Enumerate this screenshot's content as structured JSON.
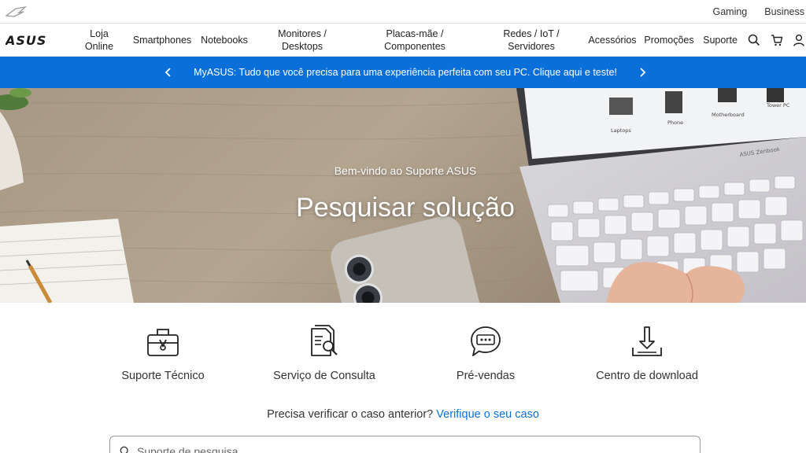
{
  "topbar": {
    "links": [
      "Gaming",
      "Business"
    ]
  },
  "nav": {
    "brand": "ASUS",
    "items": [
      {
        "line1": "Loja",
        "line2": "Online"
      },
      {
        "line1": "Smartphones",
        "line2": ""
      },
      {
        "line1": "Notebooks",
        "line2": ""
      },
      {
        "line1": "Monitores /",
        "line2": "Desktops"
      },
      {
        "line1": "Placas-mãe /",
        "line2": "Componentes"
      },
      {
        "line1": "Redes / IoT /",
        "line2": "Servidores"
      },
      {
        "line1": "Acessórios",
        "line2": ""
      },
      {
        "line1": "Promoções",
        "line2": ""
      },
      {
        "line1": "Suporte",
        "line2": ""
      }
    ],
    "icons": [
      "search-icon",
      "cart-icon",
      "user-icon"
    ]
  },
  "promo": {
    "text": "MyASUS: Tudo que você precisa para uma experiência perfeita com seu PC. Clique aqui e teste!"
  },
  "hero": {
    "subtitle": "Bem-vindo ao Suporte ASUS",
    "title": "Pesquisar solução",
    "laptop_brand": "ASUS Zenbook",
    "screen_labels": [
      "Laptops",
      "Phone",
      "Motherboard",
      "Tower PC"
    ]
  },
  "services": [
    {
      "label": "Suporte Técnico",
      "icon": "technical-support-icon"
    },
    {
      "label": "Serviço de Consulta",
      "icon": "document-search-icon"
    },
    {
      "label": "Pré-vendas",
      "icon": "chat-bubble-icon"
    },
    {
      "label": "Centro de download",
      "icon": "download-icon"
    }
  ],
  "case_check": {
    "question": "Precisa verificar o caso anterior?",
    "link": "Verifique o seu caso"
  },
  "search": {
    "placeholder": "Suporte de pesquisa"
  },
  "colors": {
    "brand_blue": "#0b6fd9",
    "hero_wood": "#cbb9a2"
  }
}
